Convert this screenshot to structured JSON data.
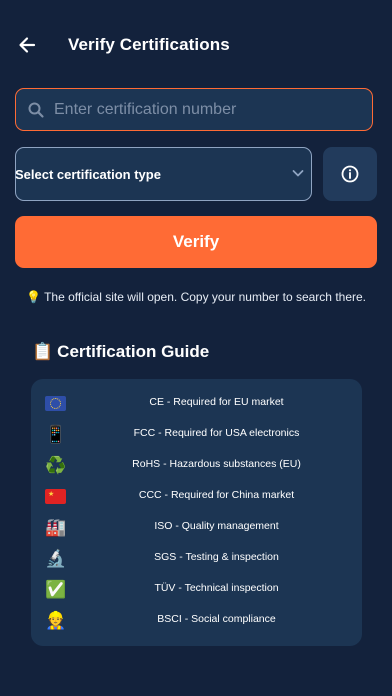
{
  "header": {
    "title": "Verify Certifications",
    "back_icon": "arrow-left-icon"
  },
  "search": {
    "placeholder": "Enter certification number",
    "value": "",
    "icon": "search-icon"
  },
  "select": {
    "label": "Select certification type",
    "icon": "chevron-down-icon"
  },
  "info_button": {
    "icon": "info-circle-icon"
  },
  "verify_button": {
    "label": "Verify"
  },
  "note": {
    "emoji": "💡",
    "text": "The official site will open. Copy your number to search there."
  },
  "guide": {
    "emoji": "📋",
    "title": "Certification Guide",
    "items": [
      {
        "icon": "eu-flag-icon",
        "glyph": "",
        "text": "CE - Required for EU market"
      },
      {
        "icon": "mobile-phone-icon",
        "glyph": "📱",
        "text": "FCC - Required for USA electronics"
      },
      {
        "icon": "recycle-icon",
        "glyph": "♻️",
        "text": "RoHS - Hazardous substances (EU)"
      },
      {
        "icon": "china-flag-icon",
        "glyph": "",
        "text": "CCC - Required for China market"
      },
      {
        "icon": "factory-icon",
        "glyph": "🏭",
        "text": "ISO - Quality management"
      },
      {
        "icon": "microscope-icon",
        "glyph": "🔬",
        "text": "SGS - Testing & inspection"
      },
      {
        "icon": "check-mark-icon",
        "glyph": "✅",
        "text": "TÜV - Technical inspection"
      },
      {
        "icon": "worker-icon",
        "glyph": "👷",
        "text": "BSCI - Social compliance"
      }
    ]
  },
  "colors": {
    "background": "#13223c",
    "card": "#1c3553",
    "accent": "#ff6b35",
    "muted": "#7d8ea6"
  }
}
